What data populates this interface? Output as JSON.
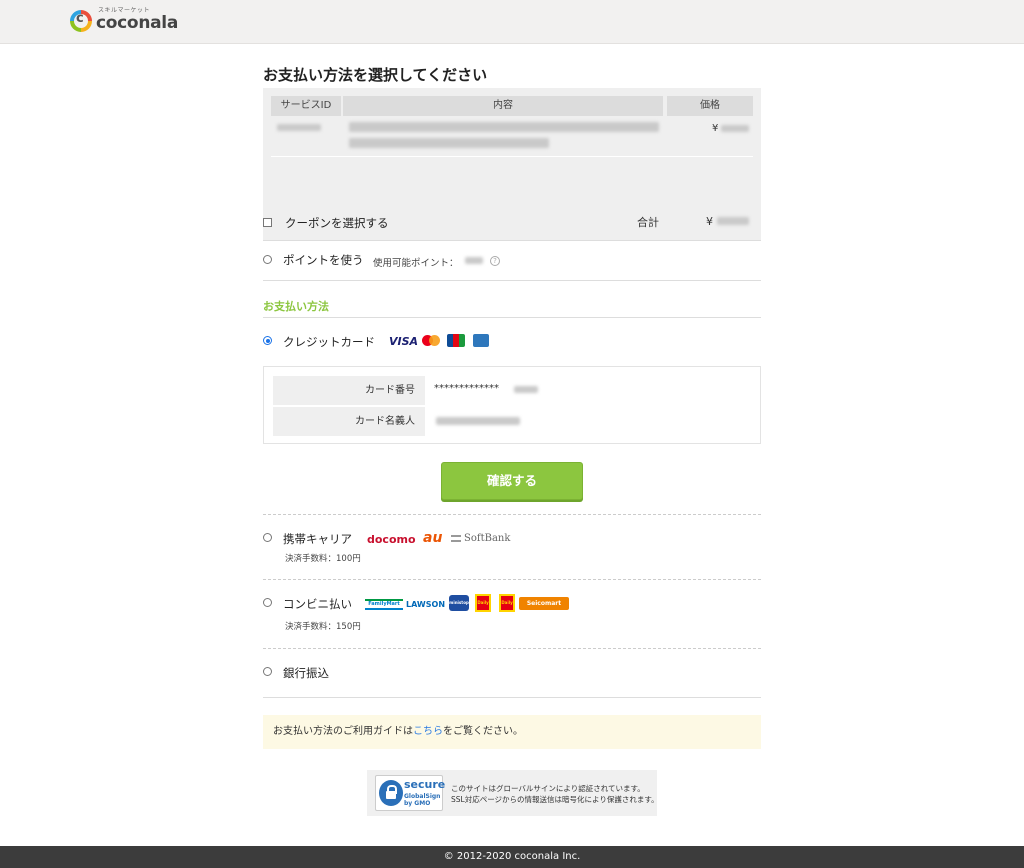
{
  "header": {
    "logo_sub": "スキルマーケット",
    "logo_main": "coconala"
  },
  "page_title": "お支払い方法を選択してください",
  "order": {
    "columns": [
      "サービスID",
      "内容",
      "価格"
    ],
    "item_price_prefix": "¥",
    "total_label": "合計",
    "total_prefix": "¥"
  },
  "coupon": {
    "label": "クーポンを選択する",
    "checked": false
  },
  "points": {
    "label": "ポイントを使う",
    "available_label": "使用可能ポイント：",
    "help": "?"
  },
  "payment_section_title": "お支払い方法",
  "credit": {
    "label": "クレジットカード",
    "selected": true,
    "brands": [
      "visa-icon",
      "mastercard-icon",
      "jcb-icon",
      "amex-icon"
    ],
    "visa_text": "VISA",
    "card_number_label": "カード番号",
    "card_number_value": "*************",
    "card_holder_label": "カード名義人"
  },
  "confirm_button": "確認する",
  "carrier": {
    "label": "携帯キャリア",
    "fee": "決済手数料：100円",
    "brands": [
      "docomo",
      "au",
      "SoftBank"
    ]
  },
  "convenience": {
    "label": "コンビニ払い",
    "fee": "決済手数料：150円",
    "stores": [
      "FamilyMart",
      "LAWSON",
      "ministop",
      "Daily",
      "Daily",
      "Seicomart"
    ]
  },
  "bank": {
    "label": "銀行振込"
  },
  "guide": {
    "before": "お支払い方法のご利用ガイドは",
    "link": "こちら",
    "after": "をご覧ください。"
  },
  "ssl": {
    "badge_word": "secure",
    "badge_small": "SSL",
    "badge_sub1": "GlobalSign",
    "badge_sub2": "by GMO",
    "line1": "このサイトはグローバルサインにより認証されています。",
    "line2": "SSL対応ページからの情報送信は暗号化により保護されます。"
  },
  "footer": "© 2012-2020 coconala Inc.",
  "colors": {
    "accent_green": "#8cc63f",
    "link_blue": "#2a7ae2",
    "footer_bg": "#3c3c3c"
  }
}
